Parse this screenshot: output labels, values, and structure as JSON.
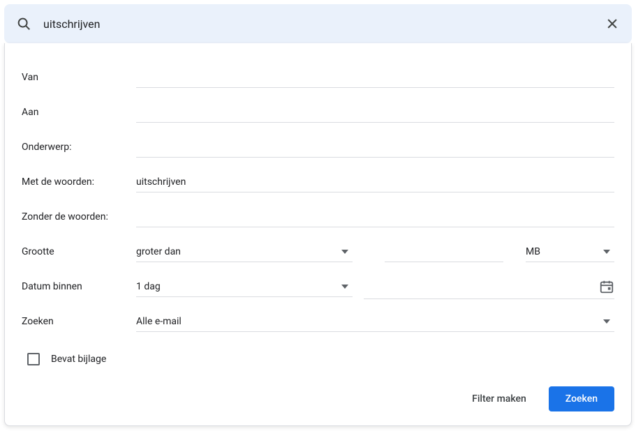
{
  "search": {
    "value": "uitschrijven"
  },
  "form": {
    "from": {
      "label": "Van",
      "value": ""
    },
    "to": {
      "label": "Aan",
      "value": ""
    },
    "subject": {
      "label": "Onderwerp:",
      "value": ""
    },
    "has_words": {
      "label": "Met de woorden:",
      "value": "uitschrijven"
    },
    "not_words": {
      "label": "Zonder de woorden:",
      "value": ""
    },
    "size": {
      "label": "Grootte",
      "operator": "groter dan",
      "value": "",
      "unit": "MB"
    },
    "date": {
      "label": "Datum binnen",
      "range": "1 dag",
      "value": ""
    },
    "search_in": {
      "label": "Zoeken",
      "value": "Alle e-mail"
    },
    "attachment": {
      "label": "Bevat bijlage",
      "checked": false
    }
  },
  "buttons": {
    "create_filter": "Filter maken",
    "search": "Zoeken"
  }
}
